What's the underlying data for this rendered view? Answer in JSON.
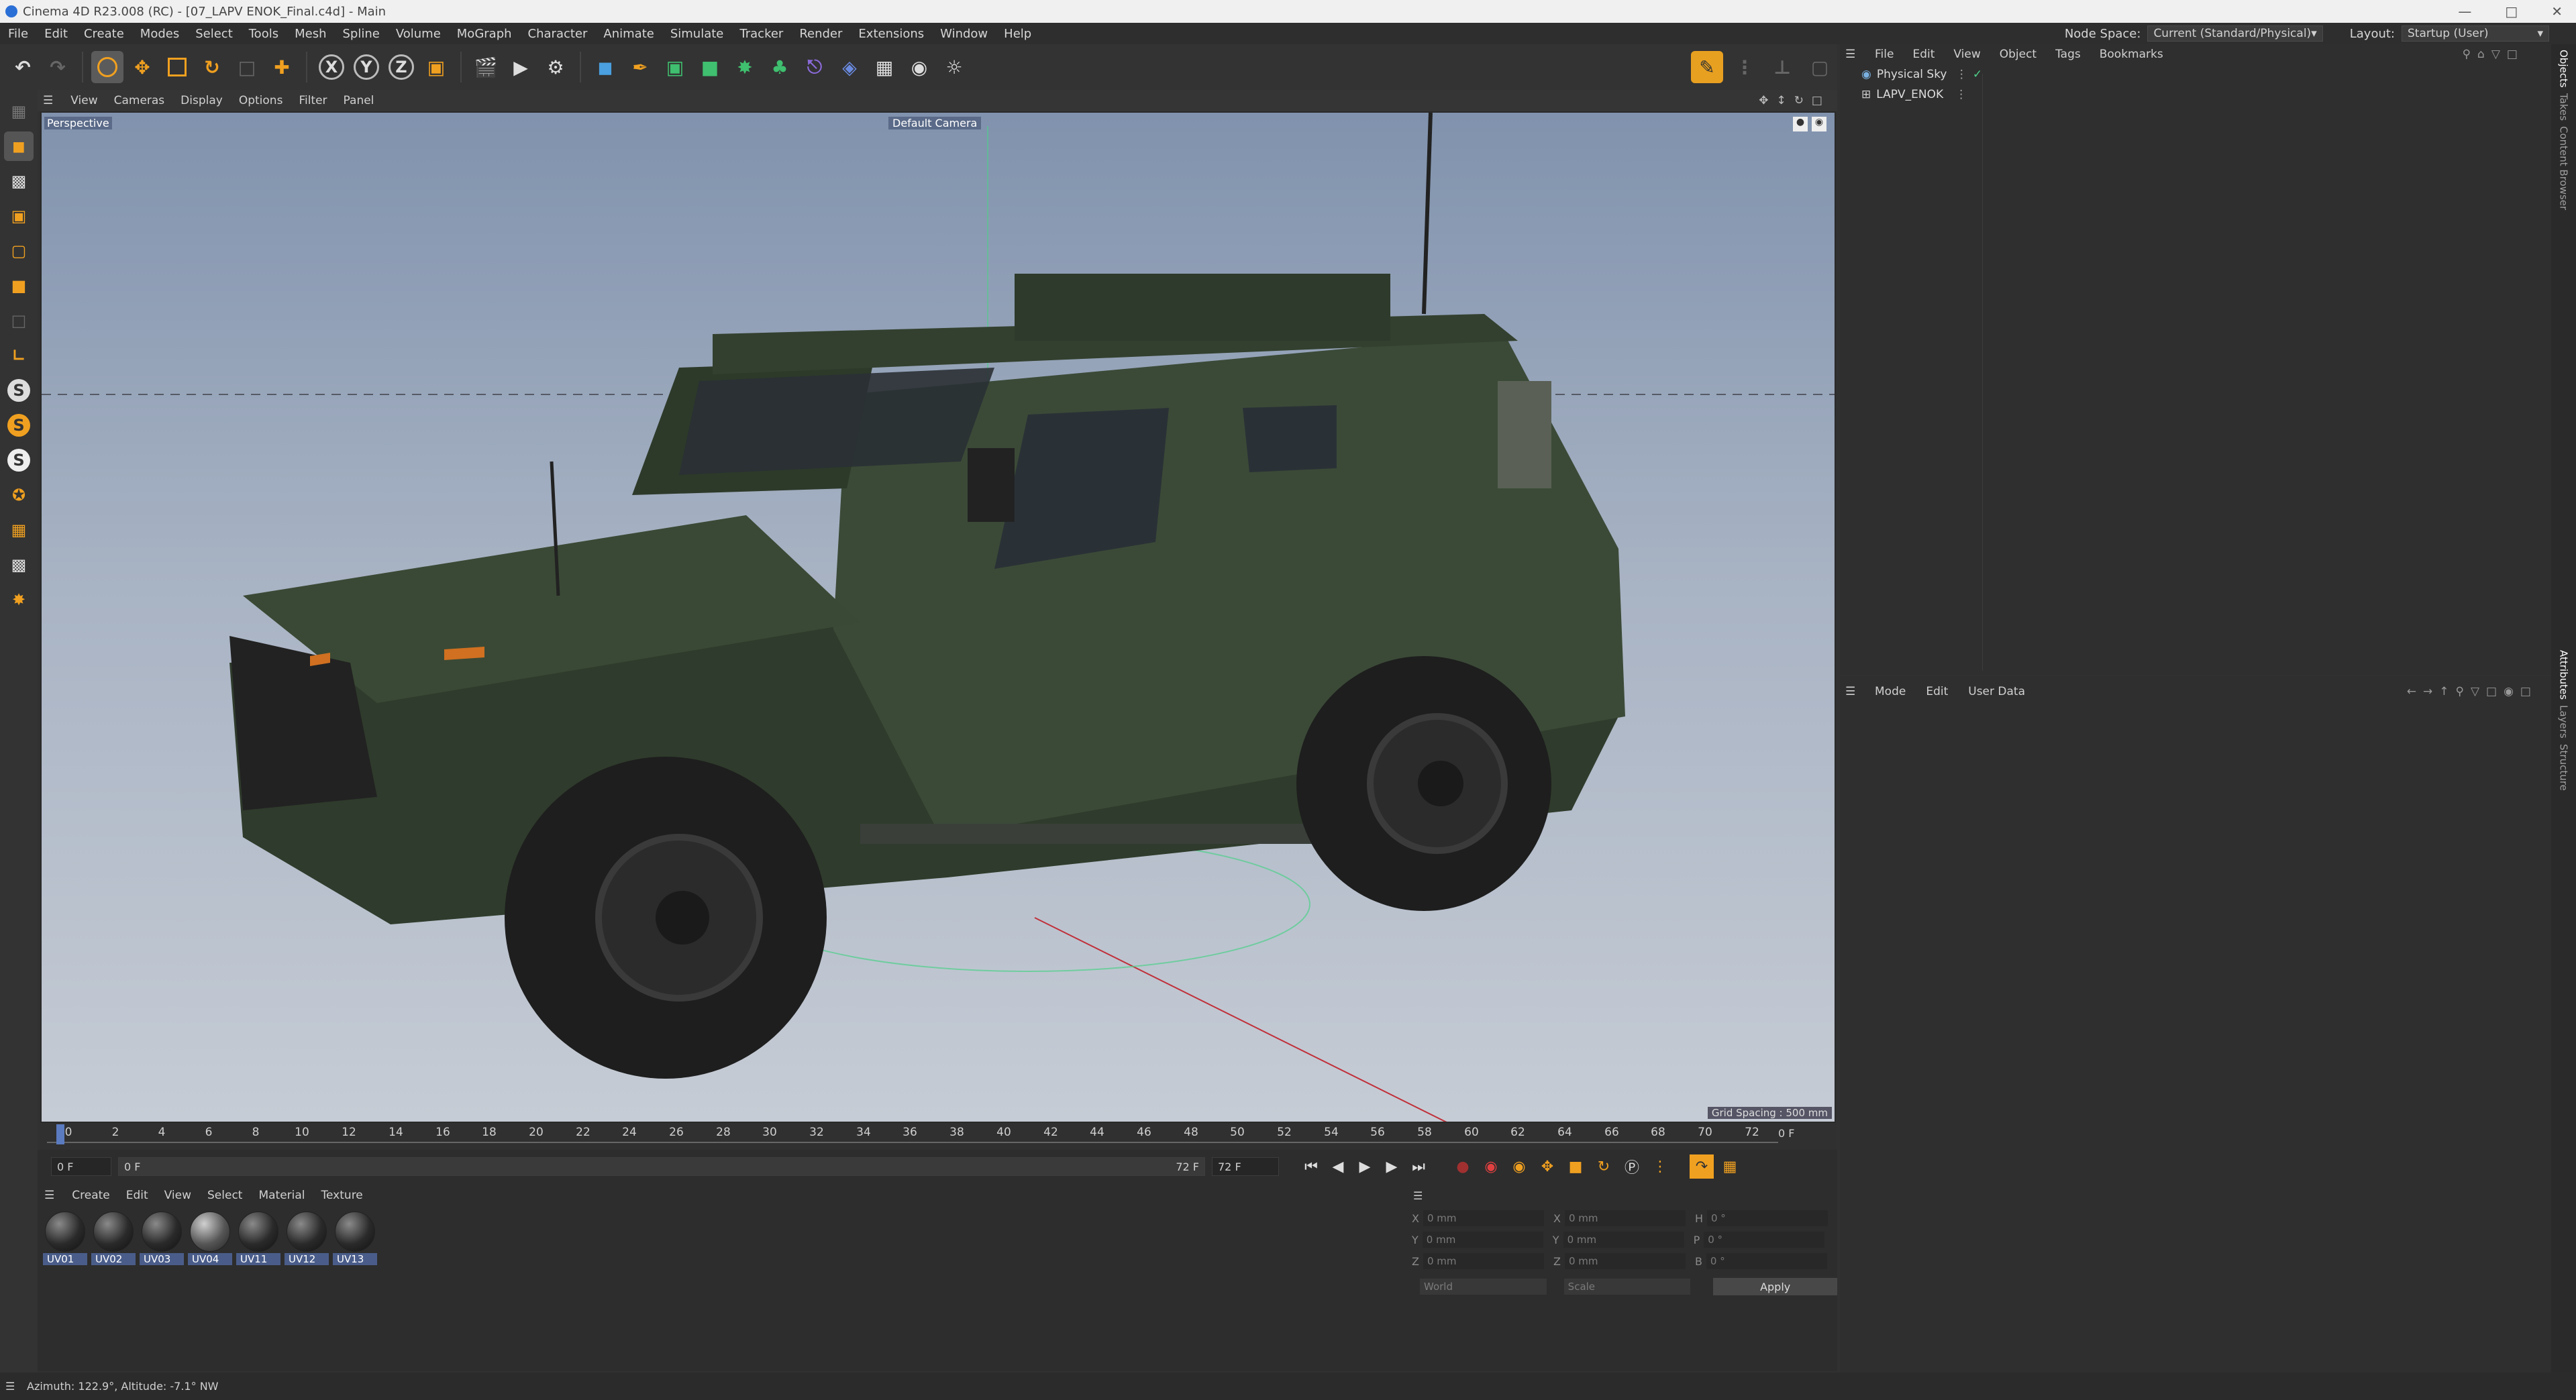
{
  "window": {
    "title": "Cinema 4D R23.008 (RC) - [07_LAPV ENOK_Final.c4d] - Main"
  },
  "menubar": {
    "items": [
      "File",
      "Edit",
      "Create",
      "Modes",
      "Select",
      "Tools",
      "Mesh",
      "Spline",
      "Volume",
      "MoGraph",
      "Character",
      "Animate",
      "Simulate",
      "Tracker",
      "Render",
      "Extensions",
      "Window",
      "Help"
    ],
    "node_space_label": "Node Space:",
    "node_space_value": "Current (Standard/Physical)",
    "layout_label": "Layout:",
    "layout_value": "Startup (User)"
  },
  "toolbar": {
    "axis_x": "X",
    "axis_y": "Y",
    "axis_z": "Z"
  },
  "lefttools": {
    "s1": "S",
    "s2": "S",
    "s3": "S"
  },
  "viewport": {
    "menu": [
      "View",
      "Cameras",
      "Display",
      "Options",
      "Filter",
      "Panel"
    ],
    "label": "Perspective",
    "camera": "Default Camera",
    "grid_spacing": "Grid Spacing : 500 mm"
  },
  "timeline": {
    "ticks": [
      "0",
      "2",
      "4",
      "6",
      "8",
      "10",
      "12",
      "14",
      "16",
      "18",
      "20",
      "22",
      "24",
      "26",
      "28",
      "30",
      "32",
      "34",
      "36",
      "38",
      "40",
      "42",
      "44",
      "46",
      "48",
      "50",
      "52",
      "54",
      "56",
      "58",
      "60",
      "62",
      "64",
      "66",
      "68",
      "70",
      "72"
    ],
    "current": "0 F"
  },
  "animbar": {
    "start": "0 F",
    "range_start": "0 F",
    "range_end": "72 F",
    "end": "72 F"
  },
  "materials": {
    "menu": [
      "Create",
      "Edit",
      "View",
      "Select",
      "Material",
      "Texture"
    ],
    "items": [
      "UV01",
      "UV02",
      "UV03",
      "UV04",
      "UV11",
      "UV12",
      "UV13"
    ]
  },
  "coords": {
    "rows": [
      {
        "a": "X",
        "av": "0 mm",
        "b": "X",
        "bv": "0 mm",
        "c": "H",
        "cv": "0 °"
      },
      {
        "a": "Y",
        "av": "0 mm",
        "b": "Y",
        "bv": "0 mm",
        "c": "P",
        "cv": "0 °"
      },
      {
        "a": "Z",
        "av": "0 mm",
        "b": "Z",
        "bv": "0 mm",
        "c": "B",
        "cv": "0 °"
      }
    ],
    "space": "World",
    "mode": "Scale",
    "apply": "Apply"
  },
  "objects": {
    "menu": [
      "File",
      "Edit",
      "View",
      "Object",
      "Tags",
      "Bookmarks"
    ],
    "items": [
      "Physical Sky",
      "LAPV_ENOK"
    ]
  },
  "attributes": {
    "menu": [
      "Mode",
      "Edit",
      "User Data"
    ]
  },
  "sidetabs": {
    "top": [
      "Objects",
      "Takes",
      "Content Browser"
    ],
    "bottom": [
      "Attributes",
      "Layers",
      "Structure"
    ]
  },
  "status": {
    "text": "Azimuth: 122.9°, Altitude: -7.1°  NW"
  },
  "colors": {
    "accent": "#4a5d8a",
    "vehicle": "#3a4a36"
  }
}
